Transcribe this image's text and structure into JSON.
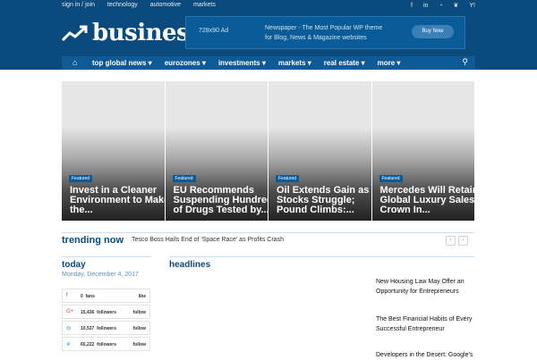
{
  "top_links": [
    "sign in / join",
    "technology",
    "automotive",
    "markets"
  ],
  "social_icons": [
    "facebook-icon",
    "linkedin-icon",
    "rss-icon",
    "twitter-icon",
    "yahoo-icon"
  ],
  "social_glyphs": [
    "f",
    "in",
    "◔",
    "❦",
    "Y!"
  ],
  "logo": {
    "text": "business"
  },
  "ad": {
    "size_label": "728x90 Ad",
    "line1": "Newspaper - The Most Popular WP theme",
    "line2": "for Blog, News & Magazine websites",
    "button": "Buy Now"
  },
  "nav": {
    "home_glyph": "⌂",
    "items": [
      "top global news ▾",
      "eurozones ▾",
      "investments ▾",
      "markets ▾",
      "real estate ▾",
      "more ▾"
    ],
    "search_glyph": "⚲"
  },
  "cards": [
    {
      "badge": "Featured",
      "line1": "Invest in a Cleaner",
      "line2": "Environment to Make",
      "line3": "the..."
    },
    {
      "badge": "Featured",
      "line1": "EU Recommends",
      "line2": "Suspending Hundreds",
      "line3": "of Drugs Tested by..."
    },
    {
      "badge": "Featured",
      "line1": "Oil Extends Gain as",
      "line2": "Stocks Struggle;",
      "line3": "Pound Climbs:..."
    },
    {
      "badge": "Featured",
      "line1": "Mercedes Will Retain",
      "line2": "Global Luxury Sales",
      "line3": "Crown In..."
    }
  ],
  "trending": {
    "label": "trending now",
    "text": "Tesco Boss Hails End of 'Space Race' as Profits Crash",
    "prev": "‹",
    "next": "›"
  },
  "today": {
    "label": "today",
    "date": "Monday, December 4, 2017"
  },
  "social_rows": [
    {
      "icon": "facebook-icon",
      "glyph": "f",
      "count": "0",
      "unit": "fans",
      "action": "like",
      "color": "#3b5998"
    },
    {
      "icon": "google-plus-icon",
      "glyph": "G+",
      "count": "15,436",
      "unit": "followers",
      "action": "follow",
      "color": "#dd4b39"
    },
    {
      "icon": "instagram-icon",
      "glyph": "◎",
      "count": "10,537",
      "unit": "followers",
      "action": "follow",
      "color": "#3f729b"
    },
    {
      "icon": "twitter-icon",
      "glyph": "❦",
      "count": "65,222",
      "unit": "followers",
      "action": "follow",
      "color": "#29c5f6"
    }
  ],
  "headlines": {
    "label": "headlines",
    "items": [
      {
        "line1": "New Housing Law May Offer an",
        "line2": "Opportunity for Entrepreneurs"
      },
      {
        "line1": "The Best Financial Habits of Every",
        "line2": "Successful Entrepreneur"
      },
      {
        "line1": "Developers in the Desert: Google's",
        "line2": ""
      }
    ]
  }
}
